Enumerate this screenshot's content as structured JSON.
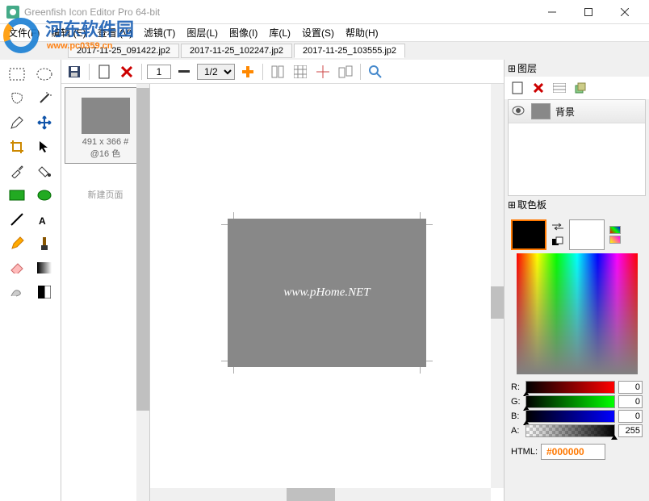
{
  "app": {
    "title": "Greenfish Icon Editor Pro 64-bit"
  },
  "watermark": {
    "site_name": "河东软件园",
    "url": "www.pc0359.cn"
  },
  "menu": {
    "file": "文件(F)",
    "edit": "编辑 (E)",
    "view": "查看 (V)",
    "filter": "滤镜(T)",
    "layer": "图层(L)",
    "image": "图像(I)",
    "library": "库(L)",
    "settings": "设置(S)",
    "help": "帮助(H)"
  },
  "tabs": [
    {
      "label": "2017-11-25_091422.jp2",
      "active": false
    },
    {
      "label": "2017-11-25_102247.jp2",
      "active": false
    },
    {
      "label": "2017-11-25_103555.jp2",
      "active": true
    }
  ],
  "toolbar": {
    "zoom_page": "1",
    "zoom_level": "1/2"
  },
  "thumbnail": {
    "size_label": "491 x 366 #",
    "colors_label": "@16 色",
    "new_page": "新建页面"
  },
  "canvas": {
    "watermark_text": "www.pHome.NET"
  },
  "panels": {
    "layers_title": "图层",
    "palette_title": "取色板",
    "bg_layer": "背景"
  },
  "color": {
    "r_label": "R:",
    "g_label": "G:",
    "b_label": "B:",
    "a_label": "A:",
    "r_value": "0",
    "g_value": "0",
    "b_value": "0",
    "a_value": "255",
    "html_label": "HTML:",
    "html_value": "#000000"
  }
}
